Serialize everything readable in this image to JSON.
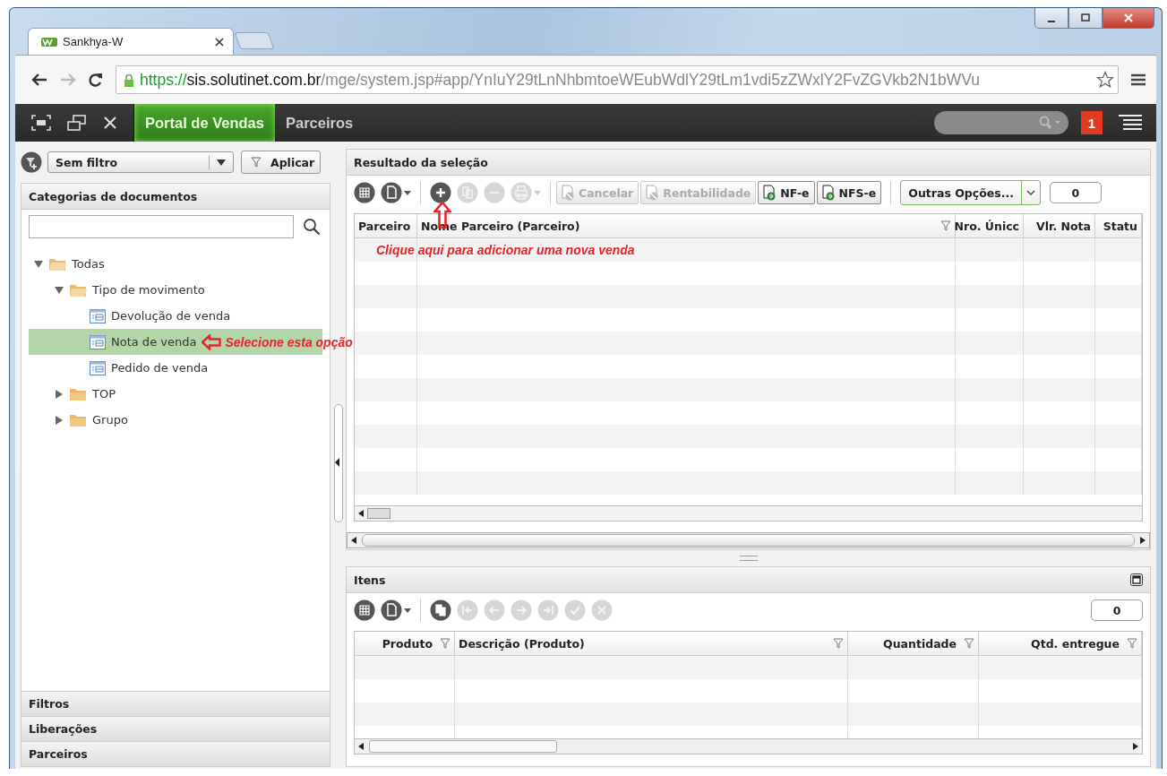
{
  "browser": {
    "tab_title": "Sankhya-W",
    "url": {
      "scheme": "https://",
      "host": "sis.solutinet.com.br",
      "path": "/mge/system.jsp#app/YnIuY29tLnNhbmtoeWEubWdlY29tLm1vdi5zZWxlY2FvZGVkb2N1bWVu"
    }
  },
  "app_bar": {
    "tabs": [
      {
        "label": "Portal de Vendas",
        "selected": true
      },
      {
        "label": "Parceiros",
        "selected": false
      }
    ],
    "notification_count": "1"
  },
  "left_panel": {
    "filter": {
      "value": "Sem filtro"
    },
    "apply_button": "Aplicar",
    "categories_title": "Categorias de documentos",
    "tree": [
      {
        "label": "Todas",
        "kind": "folder",
        "expanded": true,
        "selected": false,
        "children": [
          {
            "label": "Tipo de movimento",
            "kind": "folder",
            "expanded": true,
            "selected": false,
            "children": [
              {
                "label": "Devolução de venda",
                "kind": "document",
                "selected": false
              },
              {
                "label": "Nota de venda",
                "kind": "document",
                "selected": true
              },
              {
                "label": "Pedido de venda",
                "kind": "document",
                "selected": false
              }
            ]
          },
          {
            "label": "TOP",
            "kind": "folder",
            "expanded": false,
            "selected": false
          },
          {
            "label": "Grupo",
            "kind": "folder",
            "expanded": false,
            "selected": false
          }
        ]
      }
    ],
    "accordion": [
      "Filtros",
      "Liberações",
      "Parceiros"
    ]
  },
  "results": {
    "title": "Resultado da seleção",
    "icon_buttons": [
      {
        "kind": "grid",
        "disabled": false,
        "menu": false
      },
      {
        "kind": "document",
        "disabled": false,
        "menu": true
      },
      {
        "kind": "add",
        "disabled": false,
        "menu": false
      },
      {
        "kind": "copy",
        "disabled": true,
        "menu": false
      },
      {
        "kind": "remove",
        "disabled": true,
        "menu": false
      },
      {
        "kind": "print",
        "disabled": true,
        "menu": true
      }
    ],
    "text_buttons": [
      {
        "label": "Cancelar",
        "disabled": true
      },
      {
        "label": "Rentabilidade",
        "disabled": true
      },
      {
        "label": "NF-e",
        "disabled": false
      },
      {
        "label": "NFS-e",
        "disabled": false
      }
    ],
    "options": "Outras Opções...",
    "count": "0",
    "columns": [
      {
        "label": "Parceiro",
        "filter": false
      },
      {
        "label": "Nome Parceiro (Parceiro)",
        "filter": true
      },
      {
        "label": "Nro. Únicc",
        "filter": false
      },
      {
        "label": "Vlr. Nota",
        "filter": false
      },
      {
        "label": "Statu",
        "filter": false
      }
    ]
  },
  "annotations": [
    {
      "text": "Clique aqui para adicionar uma nova venda"
    },
    {
      "text": "Selecione esta opção"
    }
  ],
  "items": {
    "title": "Itens",
    "icon_buttons": [
      {
        "kind": "grid",
        "disabled": false,
        "menu": false
      },
      {
        "kind": "document",
        "disabled": false,
        "menu": true
      },
      {
        "kind": "copy",
        "disabled": false,
        "menu": false
      },
      {
        "kind": "first",
        "disabled": true,
        "menu": false
      },
      {
        "kind": "previous",
        "disabled": true,
        "menu": false
      },
      {
        "kind": "next",
        "disabled": true,
        "menu": false
      },
      {
        "kind": "last",
        "disabled": true,
        "menu": false
      },
      {
        "kind": "confirm",
        "disabled": true,
        "menu": false
      },
      {
        "kind": "cancel",
        "disabled": true,
        "menu": false
      }
    ],
    "count": "0",
    "columns": [
      {
        "label": "Produto",
        "filter": true
      },
      {
        "label": "Descrição (Produto)",
        "filter": true
      },
      {
        "label": "Quantidade",
        "filter": true
      },
      {
        "label": "Qtd. entregue",
        "filter": true
      }
    ]
  }
}
